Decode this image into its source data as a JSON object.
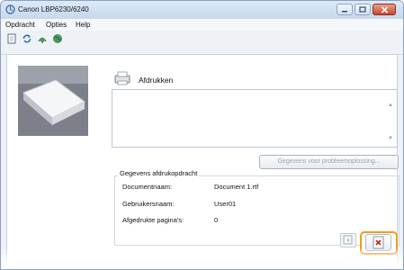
{
  "window": {
    "title": "Canon LBP6230/6240",
    "controls": {
      "minimize_icon": "minimize-icon",
      "maximize_icon": "maximize-icon",
      "close_icon": "close-icon"
    }
  },
  "menu": {
    "items": [
      "Opdracht",
      "Opties",
      "Help"
    ]
  },
  "toolbar": {
    "icons": [
      "document-icon",
      "refresh-icon",
      "network-icon",
      "globe-icon"
    ]
  },
  "status": {
    "icon": "printer-status-icon",
    "text": "Afdrukken"
  },
  "troubleshoot_button": "Gegevens voor probleemoplossing...",
  "job_group": {
    "legend": "Gegevens afdrukopdracht",
    "rows": [
      {
        "label": "Documentnaam:",
        "value": "Document 1.rtf"
      },
      {
        "label": "Gebruikersnaam:",
        "value": "User01"
      },
      {
        "label": "Afgedrukte pagina's:",
        "value": "0"
      }
    ]
  },
  "buttons": {
    "pause_icon": "pause-job-icon",
    "cancel_icon": "cancel-job-icon"
  },
  "colors": {
    "highlight": "#f39a1f",
    "cancel_x": "#cc2a1f"
  }
}
